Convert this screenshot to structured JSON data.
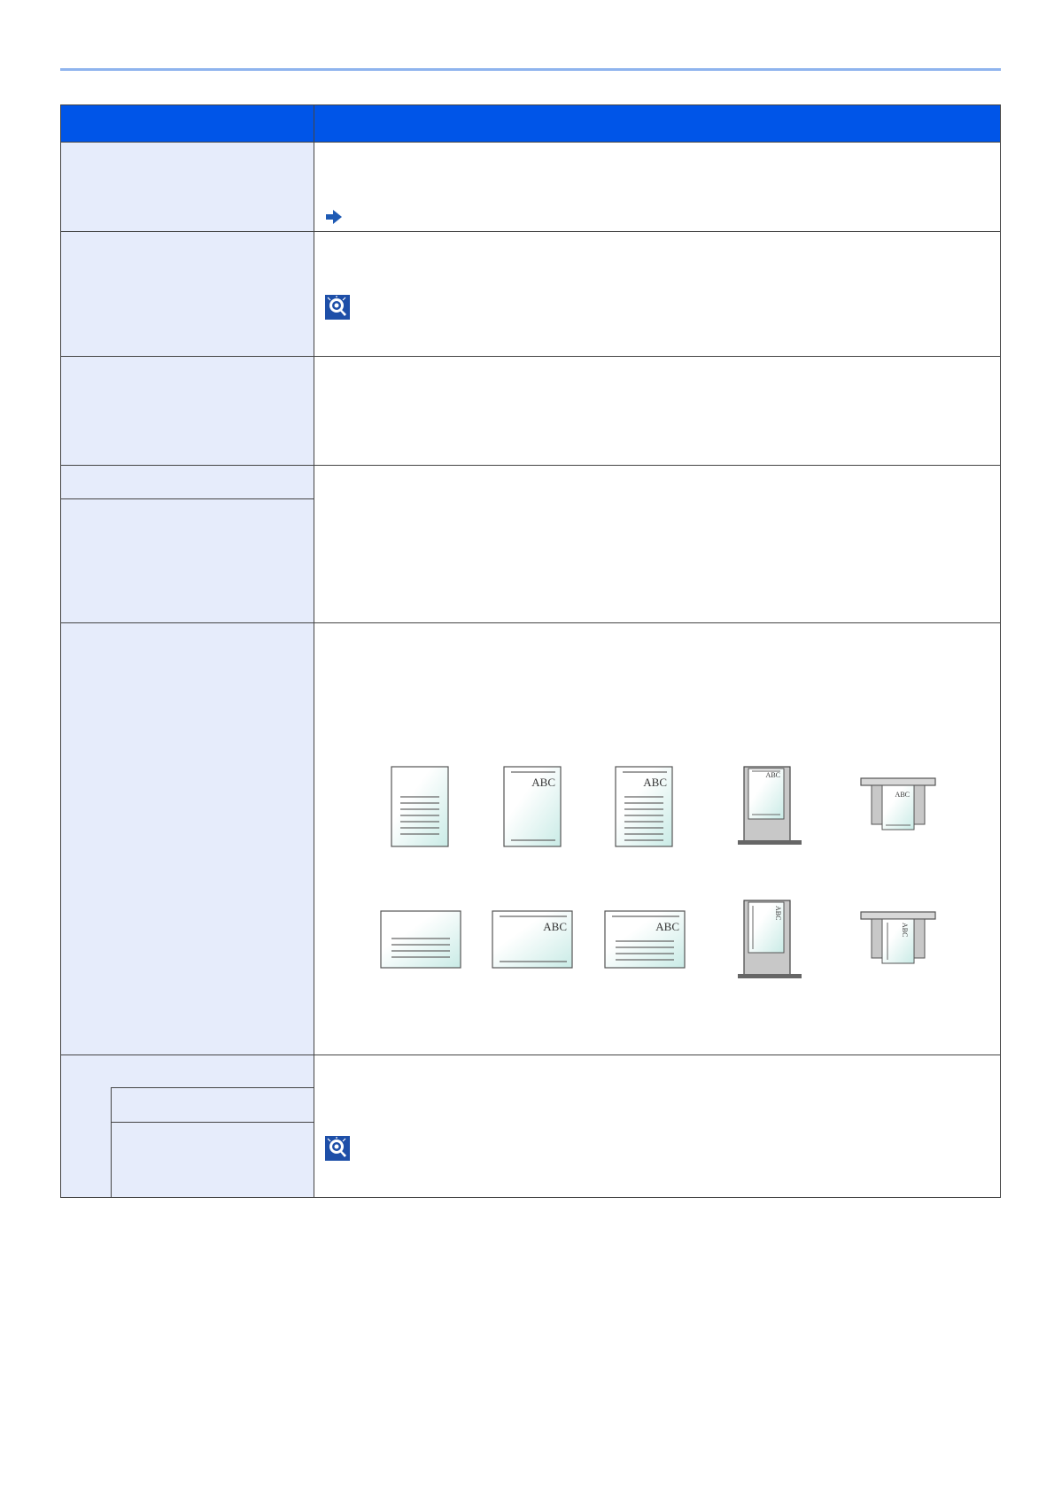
{
  "colors": {
    "header_blue": "#0055e8",
    "label_cell_bg": "#e6ecfb",
    "top_rule": "#8fb4ee",
    "link_blue": "#1e5ab4",
    "paper_gradient_end": "#c9ebe6"
  },
  "icons": {
    "link_arrow": "right-arrow-icon",
    "note": "lightbulb-note-icon"
  },
  "figures": {
    "portrait_row": [
      "portrait-text-page",
      "portrait-heading-page",
      "portrait-heading-text-page",
      "portrait-original-in-tray",
      "portrait-original-in-feeder"
    ],
    "landscape_row": [
      "landscape-text-page",
      "landscape-heading-page",
      "landscape-heading-text-page",
      "landscape-original-in-tray",
      "landscape-original-in-feeder"
    ],
    "sample_text": "ABC"
  }
}
